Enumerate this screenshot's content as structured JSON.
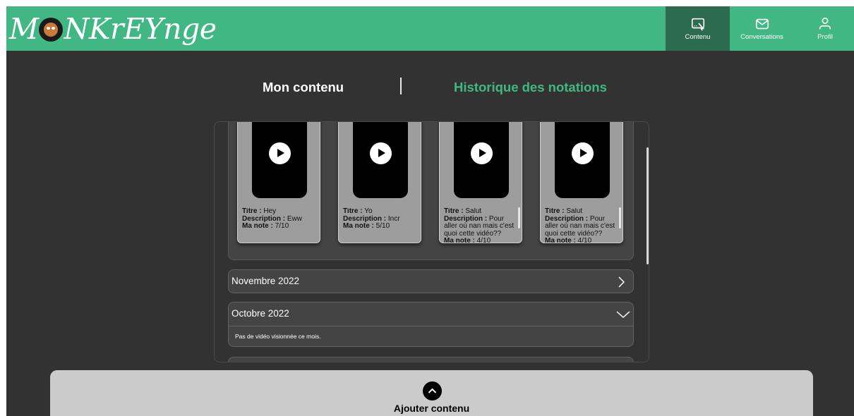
{
  "header": {
    "logo_left": "M",
    "logo_right": "NKrEYnge",
    "nav": [
      {
        "label": "Contenu",
        "icon": "content-icon",
        "active": true
      },
      {
        "label": "Conversations",
        "icon": "mail-icon",
        "active": false
      },
      {
        "label": "Profil",
        "icon": "profile-icon",
        "active": false
      }
    ]
  },
  "tabs": {
    "mine": "Mon contenu",
    "history": "Historique des notations"
  },
  "cards": [
    {
      "title_label": "Titre :",
      "title": " Hey",
      "desc_label": "Description :",
      "desc": " Eww",
      "note_label": "Ma note :",
      "note": " 7/10"
    },
    {
      "title_label": "Titre :",
      "title": " Yo",
      "desc_label": "Description :",
      "desc": " Incr",
      "note_label": "Ma note :",
      "note": " 5/10"
    },
    {
      "title_label": "Titre :",
      "title": " Salut",
      "desc_label": "Description :",
      "desc": " Pour aller où nan mais c'est quoi cette vidéo??",
      "note_label": "Ma note :",
      "note": " 4/10"
    },
    {
      "title_label": "Titre :",
      "title": " Salut",
      "desc_label": "Description :",
      "desc": " Pour aller où nan mais c'est quoi cette vidéo??",
      "note_label": "Ma note :",
      "note": " 4/10"
    }
  ],
  "months": {
    "november": "Novembre 2022",
    "october": "Octobre 2022",
    "october_empty": "Pas de vidéo visionnée ce mois."
  },
  "add": {
    "label": "Ajouter contenu"
  },
  "colors": {
    "accent": "#41b883",
    "background": "#333232",
    "nav_active": "#2d6b4f"
  }
}
